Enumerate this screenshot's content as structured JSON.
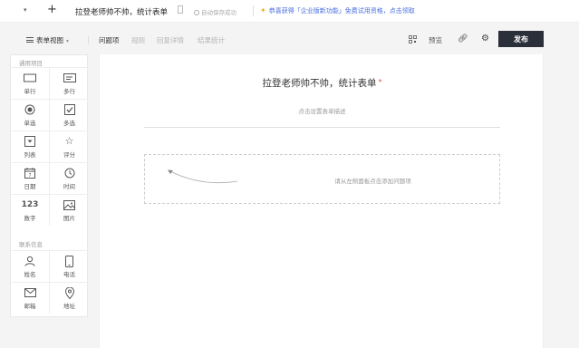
{
  "topbar": {
    "title": "拉登老师帅不帅，统计表单",
    "save_status": "自动保存成功",
    "promo": "恭喜获得「企业版新功能」免费试用资格，点击领取"
  },
  "toolbar": {
    "view_label": "表单视图",
    "tabs": [
      {
        "label": "问题项",
        "active": true
      },
      {
        "label": "规则",
        "active": false
      },
      {
        "label": "回复详情",
        "active": false
      },
      {
        "label": "结果统计",
        "active": false
      }
    ],
    "preview_label": "预览",
    "publish_label": "发布"
  },
  "sidebar": {
    "general_title": "通用项目",
    "general_items": [
      {
        "label": "单行",
        "icon": "single-line-icon"
      },
      {
        "label": "多行",
        "icon": "multi-line-icon"
      },
      {
        "label": "单选",
        "icon": "radio-icon"
      },
      {
        "label": "多选",
        "icon": "checkbox-icon"
      },
      {
        "label": "列表",
        "icon": "dropdown-icon"
      },
      {
        "label": "评分",
        "icon": "star-icon"
      },
      {
        "label": "日期",
        "icon": "calendar-icon"
      },
      {
        "label": "时间",
        "icon": "clock-icon"
      },
      {
        "label": "数字",
        "icon": "number-icon",
        "glyph": "123"
      },
      {
        "label": "图片",
        "icon": "image-icon"
      }
    ],
    "contact_title": "联系信息",
    "contact_items": [
      {
        "label": "姓名",
        "icon": "person-icon"
      },
      {
        "label": "电话",
        "icon": "phone-icon"
      },
      {
        "label": "邮箱",
        "icon": "mail-icon"
      },
      {
        "label": "地址",
        "icon": "location-icon"
      }
    ]
  },
  "form": {
    "title": "拉登老师帅不帅，统计表单",
    "required_mark": "*",
    "description_placeholder": "点击设置表单描述",
    "dropzone_hint": "请从左侧面板点击添加问题项"
  },
  "colors": {
    "publish_bg": "#2b2f3a",
    "promo_text": "#4a6ee0",
    "required": "#e05050"
  }
}
